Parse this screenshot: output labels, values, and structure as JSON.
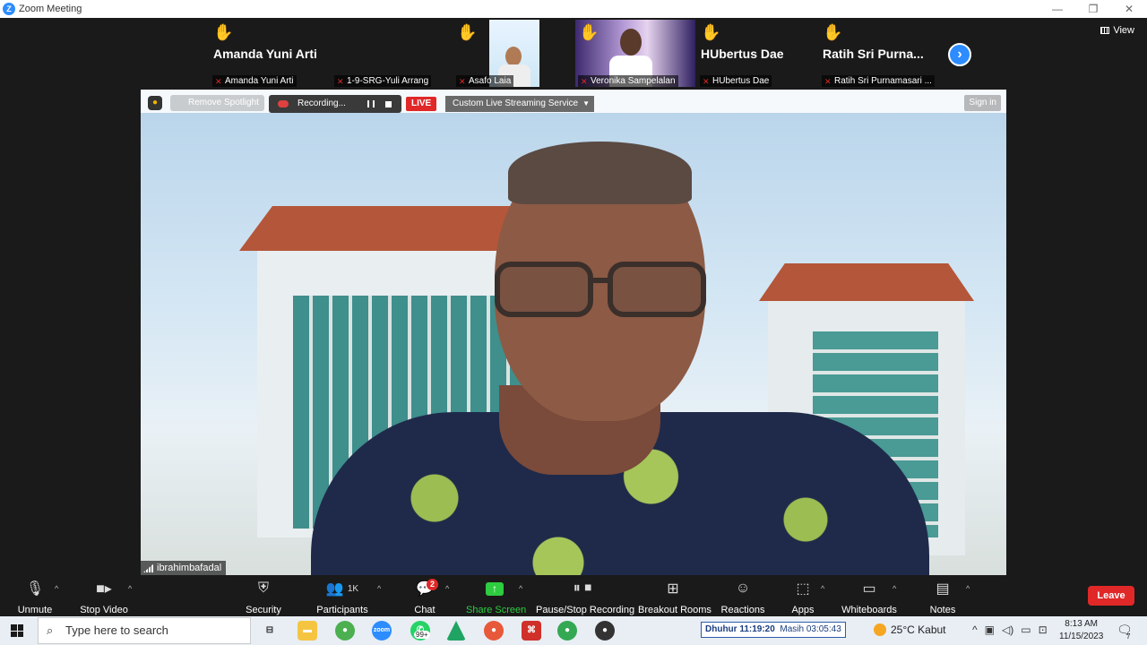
{
  "window": {
    "title": "Zoom Meeting",
    "controls": [
      "—",
      "❐",
      "✕"
    ]
  },
  "view_label": "View",
  "participants_strip": [
    {
      "big_name": "Amanda Yuni Arti",
      "label": "Amanda Yuni Arti",
      "hand_raised": true,
      "video": false
    },
    {
      "big_name": "",
      "label": "1-9-SRG-Yuli Arrang",
      "hand_raised": false,
      "video": false
    },
    {
      "big_name": "",
      "label": "Asafo Laia",
      "hand_raised": true,
      "video": true
    },
    {
      "big_name": "",
      "label": "Veronika Sampelalan",
      "hand_raised": true,
      "video": true
    },
    {
      "big_name": "HUbertus Dae",
      "label": "HUbertus Dae",
      "hand_raised": true,
      "video": false
    },
    {
      "big_name": "Ratih Sri Purna...",
      "label": "Ratih Sri Purnamasari ...",
      "hand_raised": true,
      "video": false
    }
  ],
  "spotlight_bar": {
    "remove_spotlight": "Remove Spotlight",
    "recording": "Recording...",
    "live": "LIVE",
    "stream_service": "Custom Live Streaming Service",
    "sign_in": "Sign in"
  },
  "speaker": {
    "name": "ibrahimbafadal"
  },
  "toolbar": {
    "unmute": "Unmute",
    "stop_video": "Stop Video",
    "security": "Security",
    "participants": "Participants",
    "participants_count": "1K",
    "chat": "Chat",
    "chat_badge": "2",
    "share_screen": "Share Screen",
    "pause_stop_recording": "Pause/Stop Recording",
    "breakout_rooms": "Breakout Rooms",
    "reactions": "Reactions",
    "apps": "Apps",
    "whiteboards": "Whiteboards",
    "notes": "Notes",
    "leave": "Leave"
  },
  "taskbar": {
    "search_placeholder": "Type here to search",
    "whatsapp_badge": "99+",
    "prayer_label": "Dhuhur 11:19:20",
    "prayer_remaining": "Masih 03:05:43",
    "weather": "25°C  Kabut",
    "time": "8:13 AM",
    "date": "11/15/2023",
    "notif_count": "7"
  },
  "colors": {
    "zoom_blue": "#2D8CFF",
    "leave_red": "#E02828",
    "live_red": "#E02828",
    "share_green": "#2ECC40",
    "hand_yellow": "#F5C518"
  }
}
